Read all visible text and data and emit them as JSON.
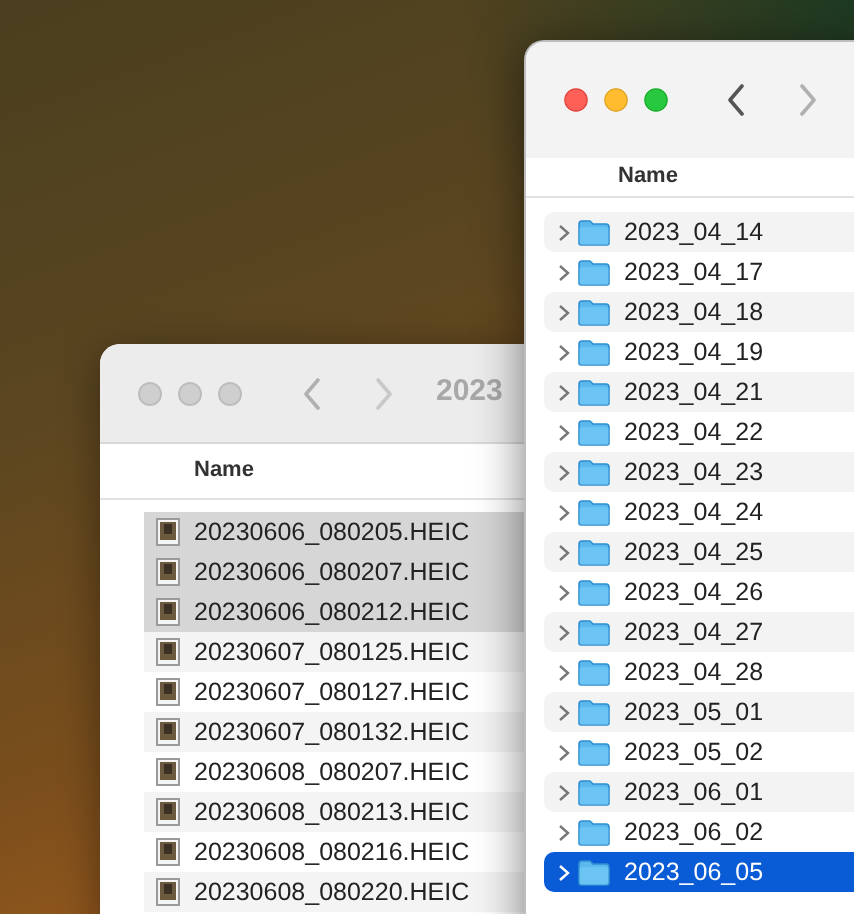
{
  "back_window": {
    "title": "2023",
    "column": "Name",
    "rows": [
      {
        "name": "20230606_080205.HEIC",
        "selected": true
      },
      {
        "name": "20230606_080207.HEIC",
        "selected": true
      },
      {
        "name": "20230606_080212.HEIC",
        "selected": true
      },
      {
        "name": "20230607_080125.HEIC",
        "selected": false
      },
      {
        "name": "20230607_080127.HEIC",
        "selected": false
      },
      {
        "name": "20230607_080132.HEIC",
        "selected": false
      },
      {
        "name": "20230608_080207.HEIC",
        "selected": false
      },
      {
        "name": "20230608_080213.HEIC",
        "selected": false
      },
      {
        "name": "20230608_080216.HEIC",
        "selected": false
      },
      {
        "name": "20230608_080220.HEIC",
        "selected": false
      }
    ]
  },
  "front_window": {
    "column": "Name",
    "rows": [
      {
        "name": "2023_04_14",
        "selected": false
      },
      {
        "name": "2023_04_17",
        "selected": false
      },
      {
        "name": "2023_04_18",
        "selected": false
      },
      {
        "name": "2023_04_19",
        "selected": false
      },
      {
        "name": "2023_04_21",
        "selected": false
      },
      {
        "name": "2023_04_22",
        "selected": false
      },
      {
        "name": "2023_04_23",
        "selected": false
      },
      {
        "name": "2023_04_24",
        "selected": false
      },
      {
        "name": "2023_04_25",
        "selected": false
      },
      {
        "name": "2023_04_26",
        "selected": false
      },
      {
        "name": "2023_04_27",
        "selected": false
      },
      {
        "name": "2023_04_28",
        "selected": false
      },
      {
        "name": "2023_05_01",
        "selected": false
      },
      {
        "name": "2023_05_02",
        "selected": false
      },
      {
        "name": "2023_06_01",
        "selected": false
      },
      {
        "name": "2023_06_02",
        "selected": false
      },
      {
        "name": "2023_06_05",
        "selected": true
      }
    ]
  }
}
